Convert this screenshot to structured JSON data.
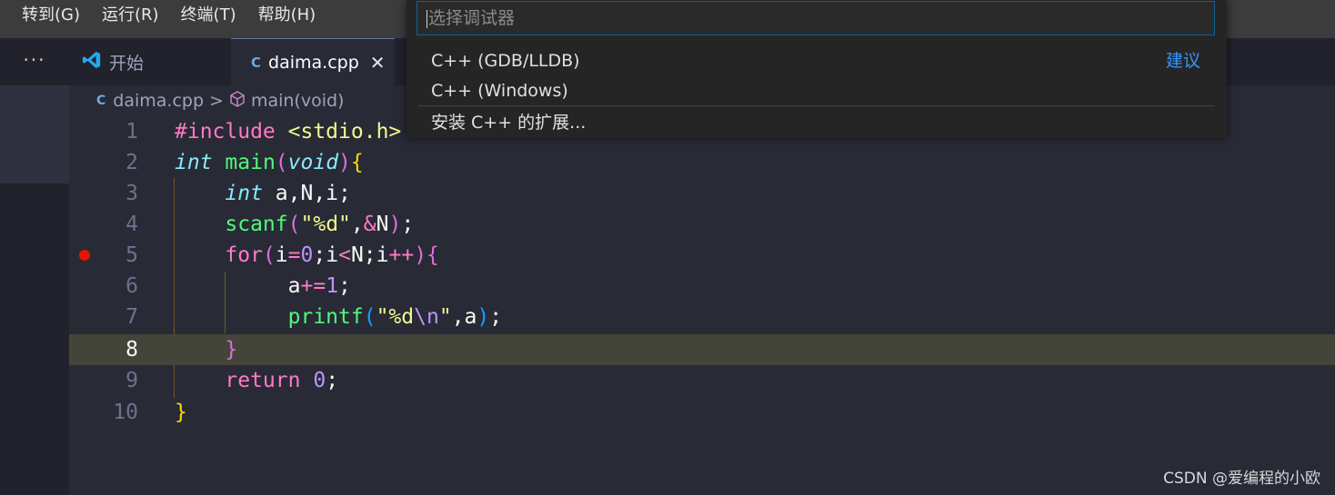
{
  "menu": [
    "转到(G)",
    "运行(R)",
    "终端(T)",
    "帮助(H)"
  ],
  "activity": {
    "more_label": "···"
  },
  "tabs": [
    {
      "label": "开始"
    },
    {
      "label": "daima.cpp",
      "close": "✕"
    }
  ],
  "breadcrumb": {
    "file": "daima.cpp",
    "symbol": "main(void)",
    "separator": ">"
  },
  "picker": {
    "placeholder": "选择调试器",
    "items": [
      "C++ (GDB/LLDB)",
      "C++ (Windows)",
      "安装 C++ 的扩展..."
    ],
    "hint": "建议"
  },
  "editor": {
    "line_numbers": [
      "1",
      "2",
      "3",
      "4",
      "5",
      "6",
      "7",
      "8",
      "9",
      "10"
    ],
    "current_line": 8,
    "breakpoint_line": 5
  },
  "watermark": "CSDN @爱编程的小欧",
  "colors": {
    "accent": "#3794ff",
    "breakpoint": "#e51400",
    "background": "#282a36"
  }
}
